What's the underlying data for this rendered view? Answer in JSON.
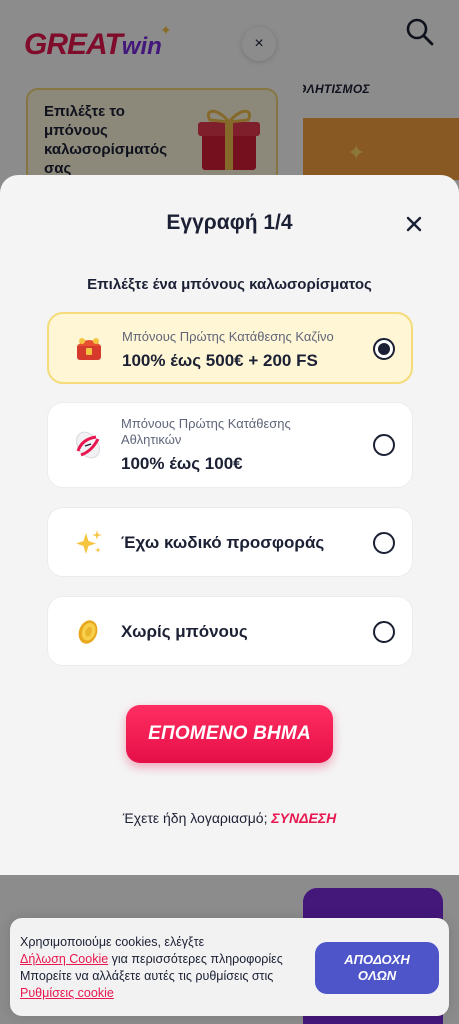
{
  "background": {
    "logo_main": "GREAT",
    "logo_sub": "win",
    "drawer_close_glyph": "×",
    "promo_text": "Επιλέξτε το μπόνους καλωσορίσματός σας",
    "sports_label": "ΘΛΗΤΙΣΜΟΣ"
  },
  "modal": {
    "title": "Εγγραφή 1/4",
    "subtitle": "Επιλέξτε ένα μπόνους καλωσορίσματος",
    "options": [
      {
        "small": "Μπόνους Πρώτης Κατάθεσης Καζίνο",
        "big": "100% έως 500€ + 200 FS",
        "icon": "casino-chest-icon",
        "selected": true
      },
      {
        "small": "Μπόνους Πρώτης Κατάθεσης Αθλητικών",
        "big": "100% έως 100€",
        "icon": "football-icon",
        "selected": false
      },
      {
        "single": "Έχω κωδικό προσφοράς",
        "icon": "sparkles-icon",
        "selected": false
      },
      {
        "single": "Χωρίς μπόνους",
        "icon": "coin-icon",
        "selected": false
      }
    ],
    "next_label": "ΕΠΟΜΕΝΟ ΒΗΜΑ",
    "login_prompt": "Έχετε ήδη λογαριασμό;",
    "login_link": "ΣΥΝΔΕΣΗ"
  },
  "cookie": {
    "line1": "Χρησιμοποιούμε cookies, ελέγξτε",
    "link1": "Δήλωση Cookie",
    "line2": " για περισσότερες πληροφορίες",
    "line3": "Μπορείτε να αλλάξετε αυτές τις ρυθμίσεις στις",
    "link2": "Ρυθμίσεις cookie",
    "accept_label": "ΑΠΟΔΟΧΗ ΟΛΩΝ"
  },
  "colors": {
    "brand_red": "#e8174f",
    "brand_purple": "#7c2be0",
    "accept_blue": "#4d55c9",
    "selected_bg": "#fff6d5"
  }
}
